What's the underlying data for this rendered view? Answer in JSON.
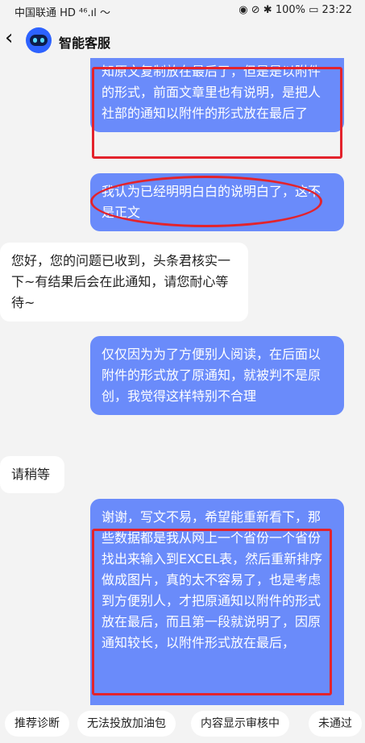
{
  "status": {
    "carrier": "中国联通 HD ⁴⁶.ıl 〜",
    "right": "◉ ⊘ ✱ 100% ▭ 23:22"
  },
  "header": {
    "back_icon": "‹",
    "title": "智能客服"
  },
  "messages": [
    {
      "role": "user",
      "text": "知原文复制放在最后了，但是是以附件的形式，前面文章里也有说明，是把人社部的通知以附件的形式放在最后了"
    },
    {
      "role": "user",
      "text": "我认为已经明明白白的说明白了，这不是正文"
    },
    {
      "role": "bot",
      "text": "您好，您的问题已收到，头条君核实一下~有结果后会在此通知，请您耐心等待~"
    },
    {
      "role": "user",
      "text": "仅仅因为为了方便别人阅读，在后面以附件的形式放了原通知，就被判不是原创，我觉得这样特别不合理"
    },
    {
      "role": "bot",
      "text": "请稍等"
    },
    {
      "role": "user",
      "text": "谢谢，写文不易，希望能重新看下，那些数据都是我从网上一个省份一个省份找出来输入到EXCEL表，然后重新排序做成图片，真的太不容易了，也是考虑到方便别人，才把原通知以附件的形式放在最后，而且第一段就说明了，因原通知较长，以附件形式放在最后，"
    }
  ],
  "chips": [
    "推荐诊断",
    "无法投放加油包",
    "内容显示审核中",
    "未通过"
  ]
}
